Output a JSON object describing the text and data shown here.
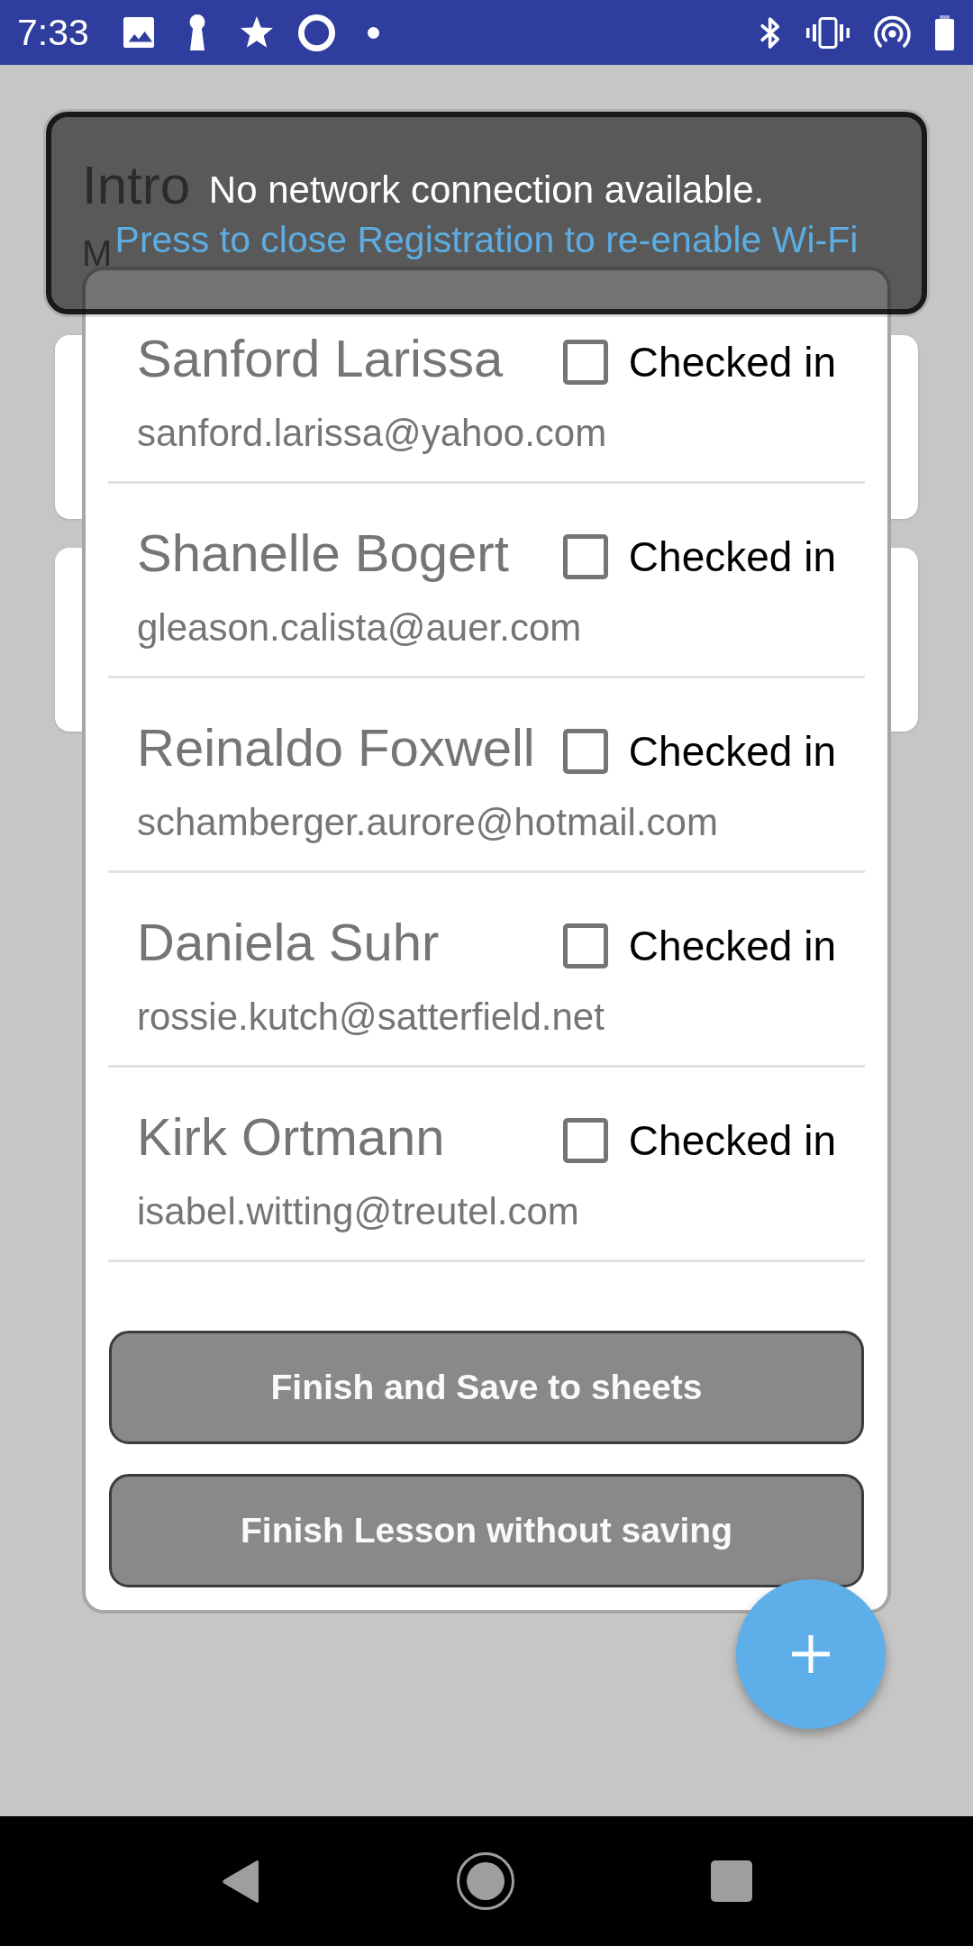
{
  "status_bar": {
    "time": "7:33"
  },
  "page": {
    "title": "Intro",
    "subtitle": "M"
  },
  "toast": {
    "message": "No network connection available.",
    "action": "Press to close Registration to re-enable Wi-Fi"
  },
  "dialog": {
    "attendees": [
      {
        "name": "Sanford Larissa",
        "email": "sanford.larissa@yahoo.com",
        "checked": false,
        "checkbox_label": "Checked in"
      },
      {
        "name": "Shanelle Bogert",
        "email": "gleason.calista@auer.com",
        "checked": false,
        "checkbox_label": "Checked in"
      },
      {
        "name": "Reinaldo Foxwell",
        "email": "schamberger.aurore@hotmail.com",
        "checked": false,
        "checkbox_label": "Checked in"
      },
      {
        "name": "Daniela Suhr",
        "email": "rossie.kutch@satterfield.net",
        "checked": false,
        "checkbox_label": "Checked in"
      },
      {
        "name": "Kirk Ortmann",
        "email": "isabel.witting@treutel.com",
        "checked": false,
        "checkbox_label": "Checked in"
      }
    ],
    "buttons": [
      "Finish and Save to sheets",
      "Finish Lesson without saving"
    ]
  }
}
